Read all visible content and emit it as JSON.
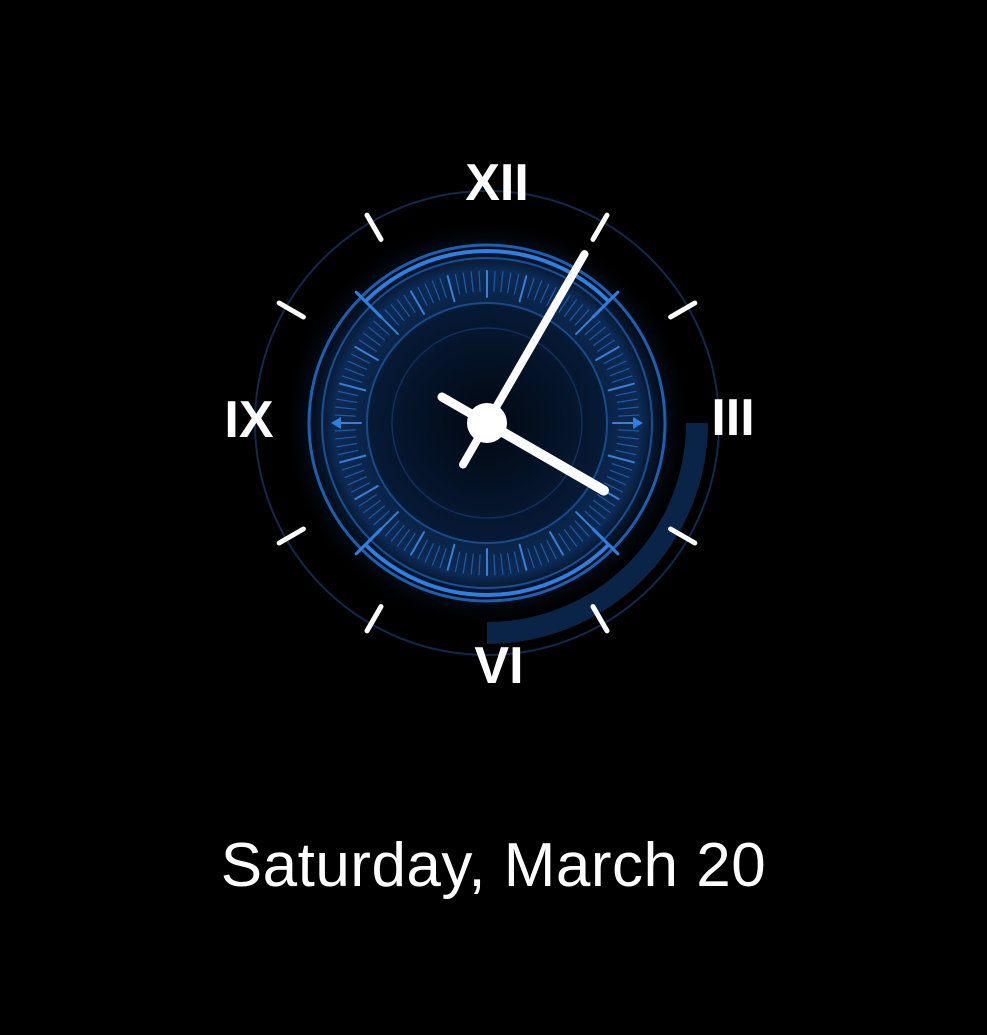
{
  "clock": {
    "numerals": {
      "top": "XII",
      "right": "III",
      "bottom": "VI",
      "left": "IX"
    },
    "time": {
      "hour": 4,
      "minute": 5
    },
    "colors": {
      "accent": "#2f7fe0",
      "accent_dark": "#123a6e",
      "hands": "#ffffff",
      "background": "#000000"
    }
  },
  "date": {
    "label": "Saturday, March 20"
  }
}
